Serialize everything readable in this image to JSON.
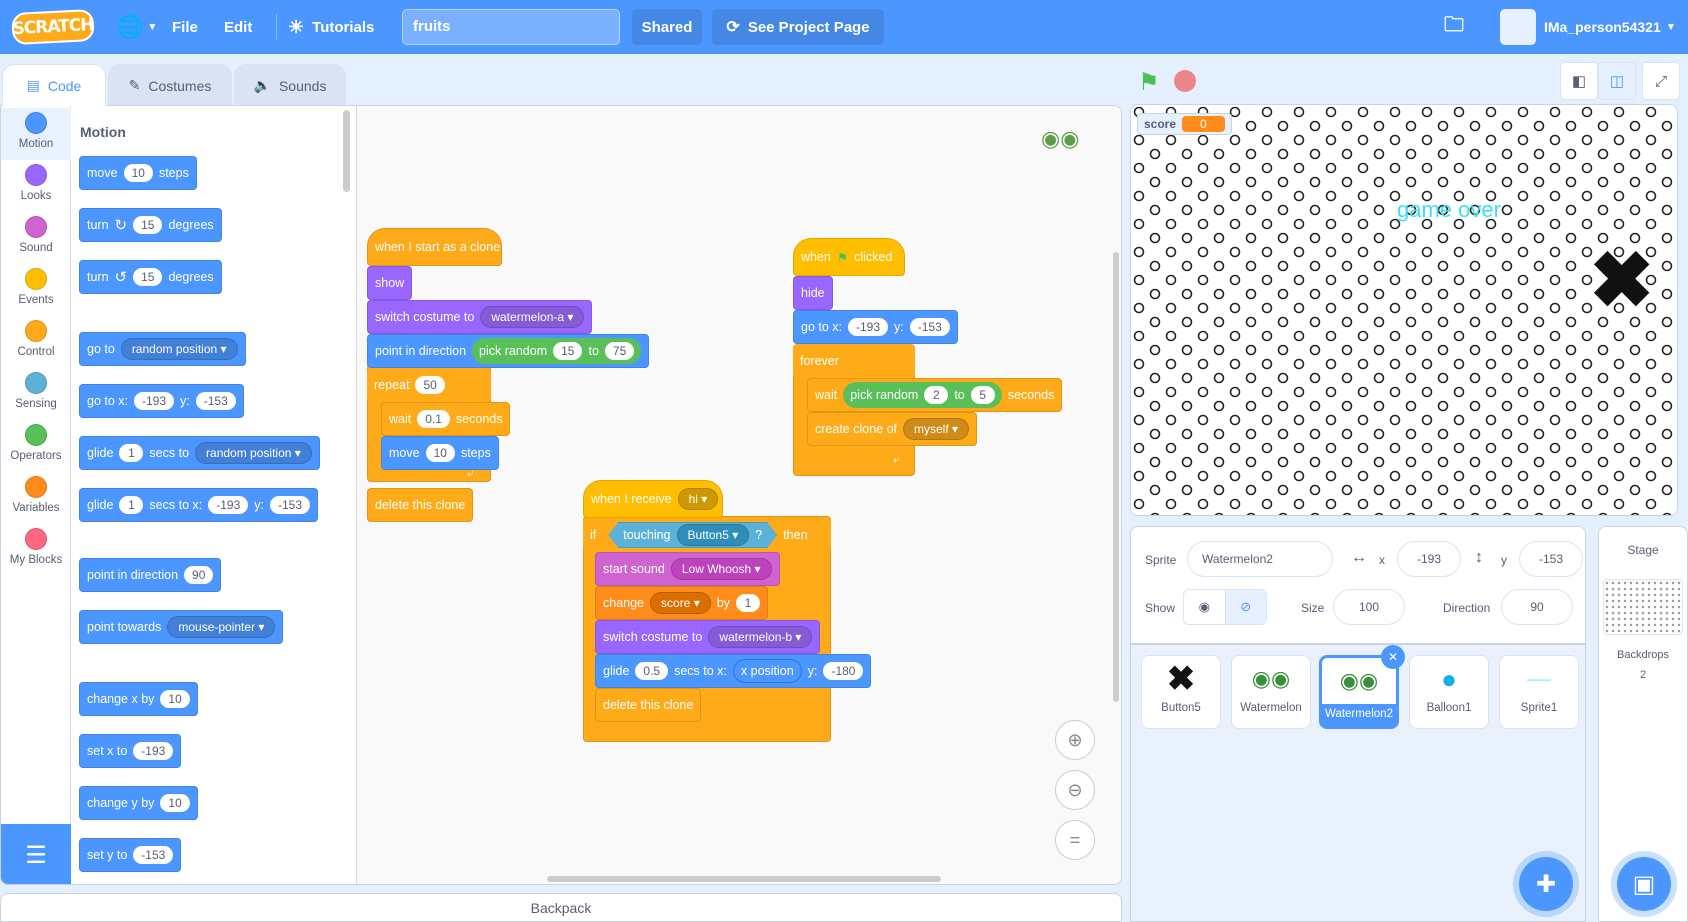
{
  "menubar": {
    "logo": "SCRATCH",
    "file": "File",
    "edit": "Edit",
    "tutorials": "Tutorials",
    "project_title": "fruits",
    "shared": "Shared",
    "see_project": "See Project Page",
    "username": "IMa_person54321"
  },
  "tabs": {
    "code": "Code",
    "costumes": "Costumes",
    "sounds": "Sounds"
  },
  "categories": [
    {
      "label": "Motion",
      "color": "#4c97ff"
    },
    {
      "label": "Looks",
      "color": "#9966ff"
    },
    {
      "label": "Sound",
      "color": "#cf63cf"
    },
    {
      "label": "Events",
      "color": "#ffbf00"
    },
    {
      "label": "Control",
      "color": "#ffab19"
    },
    {
      "label": "Sensing",
      "color": "#5cb1d6"
    },
    {
      "label": "Operators",
      "color": "#59c059"
    },
    {
      "label": "Variables",
      "color": "#ff8c1a"
    },
    {
      "label": "My Blocks",
      "color": "#ff6680"
    }
  ],
  "palette": {
    "title": "Motion",
    "move": {
      "a": "move",
      "v": "10",
      "b": "steps"
    },
    "turn_cw": {
      "a": "turn",
      "v": "15",
      "b": "degrees"
    },
    "turn_ccw": {
      "a": "turn",
      "v": "15",
      "b": "degrees"
    },
    "goto": {
      "a": "go to",
      "d": "random position"
    },
    "gotoxy": {
      "a": "go to x:",
      "x": "-193",
      "ylab": "y:",
      "y": "-153"
    },
    "glide": {
      "a": "glide",
      "v": "1",
      "b": "secs to",
      "d": "random position"
    },
    "glidexy": {
      "a": "glide",
      "v": "1",
      "b": "secs to x:",
      "x": "-193",
      "ylab": "y:",
      "y": "-153"
    },
    "point_dir": {
      "a": "point in direction",
      "v": "90"
    },
    "point_towards": {
      "a": "point towards",
      "d": "mouse-pointer"
    },
    "change_x": {
      "a": "change x by",
      "v": "10"
    },
    "set_x": {
      "a": "set x to",
      "v": "-193"
    },
    "change_y": {
      "a": "change y by",
      "v": "10"
    },
    "set_y": {
      "a": "set y to",
      "v": "-153"
    }
  },
  "script1": {
    "hat": "when I start as a clone",
    "show": "show",
    "switch": {
      "a": "switch costume to",
      "d": "watermelon-a"
    },
    "point": {
      "a": "point in direction",
      "op": "pick random",
      "v1": "15",
      "to": "to",
      "v2": "75"
    },
    "repeat": {
      "a": "repeat",
      "v": "50"
    },
    "wait": {
      "a": "wait",
      "v": "0.1",
      "b": "seconds"
    },
    "move": {
      "a": "move",
      "v": "10",
      "b": "steps"
    },
    "delete": "delete this clone"
  },
  "script2": {
    "hat_a": "when",
    "hat_b": "clicked",
    "hide": "hide",
    "gotoxy": {
      "a": "go to x:",
      "x": "-193",
      "ylab": "y:",
      "y": "-153"
    },
    "forever": "forever",
    "wait": {
      "a": "wait",
      "op": "pick random",
      "v1": "2",
      "to": "to",
      "v2": "5",
      "b": "seconds"
    },
    "clone": {
      "a": "create clone of",
      "d": "myself"
    }
  },
  "script3": {
    "hat": {
      "a": "when I receive",
      "d": "hi"
    },
    "if": {
      "a": "if",
      "touch": "touching",
      "d": "Button5",
      "q": "?",
      "b": "then"
    },
    "sound": {
      "a": "start sound",
      "d": "Low Whoosh"
    },
    "change": {
      "a": "change",
      "d": "score",
      "b": "by",
      "v": "1"
    },
    "switch": {
      "a": "switch costume to",
      "d": "watermelon-b"
    },
    "glide": {
      "a": "glide",
      "v": "0.5",
      "b": "secs to x:",
      "x": "x position",
      "ylab": "y:",
      "y": "-180"
    },
    "delete": "delete this clone"
  },
  "stage": {
    "score_label": "score",
    "score_value": "0",
    "game_over": "game over"
  },
  "sprite_info": {
    "sprite_label": "Sprite",
    "sprite_name": "Watermelon2",
    "x_label": "x",
    "x": "-193",
    "y_label": "y",
    "y": "-153",
    "show_label": "Show",
    "size_label": "Size",
    "size": "100",
    "direction_label": "Direction",
    "direction": "90"
  },
  "sprites": [
    {
      "name": "Button5",
      "icon": "x-mark-icon"
    },
    {
      "name": "Watermelon",
      "icon": "watermelon-icon"
    },
    {
      "name": "Watermelon2",
      "icon": "watermelon-icon",
      "selected": true
    },
    {
      "name": "Balloon1",
      "icon": "balloon-icon"
    },
    {
      "name": "Sprite1",
      "icon": "game-over-text-icon"
    }
  ],
  "stage_pane": {
    "title": "Stage",
    "backdrops_label": "Backdrops",
    "backdrops_count": "2"
  },
  "backpack": "Backpack",
  "colors": {
    "accent": "#4c97ff",
    "motion": "#4c97ff",
    "looks": "#9966ff",
    "control": "#ffab19"
  }
}
